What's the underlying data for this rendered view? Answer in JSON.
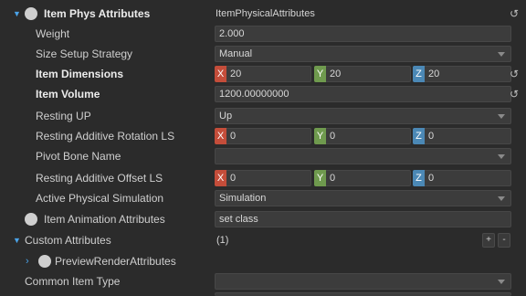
{
  "rows": [
    {
      "label": "Item Phys Attributes",
      "value": "ItemPhysicalAttributes"
    },
    {
      "label": "Weight",
      "value": "2.000"
    },
    {
      "label": "Size Setup Strategy",
      "value": "Manual"
    },
    {
      "label": "Item Dimensions",
      "x": "20",
      "y": "20",
      "z": "20"
    },
    {
      "label": "Item Volume",
      "value": "1200.00000000"
    },
    {
      "label": "Resting UP",
      "value": "Up"
    },
    {
      "label": "Resting Additive Rotation LS",
      "x": "0",
      "y": "0",
      "z": "0"
    },
    {
      "label": "Pivot Bone Name",
      "value": ""
    },
    {
      "label": "Resting Additive Offset LS",
      "x": "0",
      "y": "0",
      "z": "0"
    },
    {
      "label": "Active Physical Simulation",
      "value": "Simulation"
    },
    {
      "label": "Item Animation Attributes",
      "value": "set class"
    },
    {
      "label": "Custom Attributes",
      "value": "(1)"
    },
    {
      "label": "PreviewRenderAttributes",
      "value": ""
    },
    {
      "label": "Common Item Type",
      "value": ""
    }
  ],
  "axis_labels": {
    "x": "X",
    "y": "Y",
    "z": "Z"
  },
  "icons": {
    "reset": "reset-arrow-icon",
    "expand_open": "triangle-down-icon",
    "expand_closed": "chevron-right-icon",
    "object": "circle-icon",
    "dropdown": "caret-down-icon"
  },
  "buttons": {
    "add": "+",
    "remove": "-"
  },
  "colors": {
    "background": "#2b2b2b",
    "field": "#3c3c3c",
    "accent": "#4aa3e8",
    "axis_x": "#c44d3a",
    "axis_y": "#6f9a4e",
    "axis_z": "#4b88b5"
  }
}
